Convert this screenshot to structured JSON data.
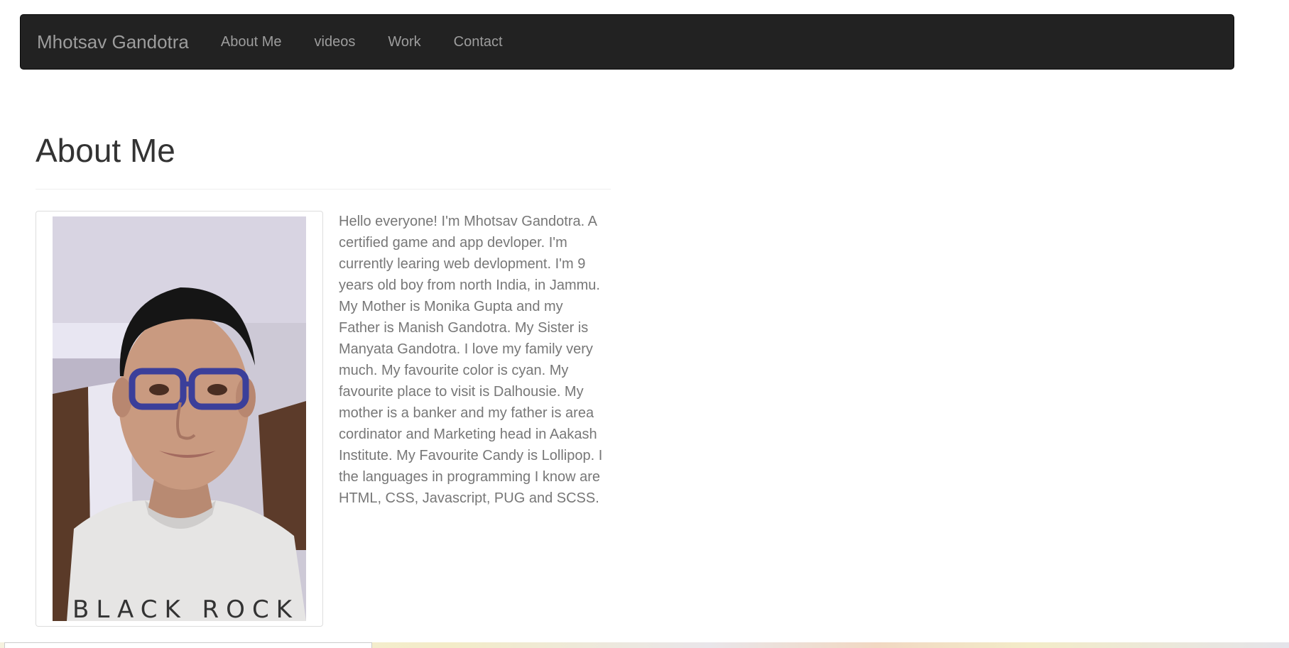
{
  "navbar": {
    "brand": "Mhotsav Gandotra",
    "links": [
      {
        "label": "About Me"
      },
      {
        "label": "videos"
      },
      {
        "label": "Work"
      },
      {
        "label": "Contact"
      }
    ]
  },
  "main": {
    "title": "About Me",
    "bio": "Hello everyone! I'm Mhotsav Gandotra. A certified game and app devloper. I'm currently learing web devlopment. I'm 9 years old boy from north India, in Jammu. My Mother is Monika Gupta and my Father is Manish Gandotra. My Sister is Manyata Gandotra. I love my family very much. My favourite color is cyan. My favourite place to visit is Dalhousie. My mother is a banker and my father is area cordinator and Marketing head in Aakash Institute. My Favourite Candy is Lollipop. I the languages in programming I know are HTML, CSS, Javascript, PUG and SCSS.",
    "photo_shirt_text": "BLACK ROCK"
  },
  "colors": {
    "navbar_bg": "#222222",
    "nav_text": "#9d9d9d",
    "title_text": "#333333",
    "body_text": "#777777"
  }
}
